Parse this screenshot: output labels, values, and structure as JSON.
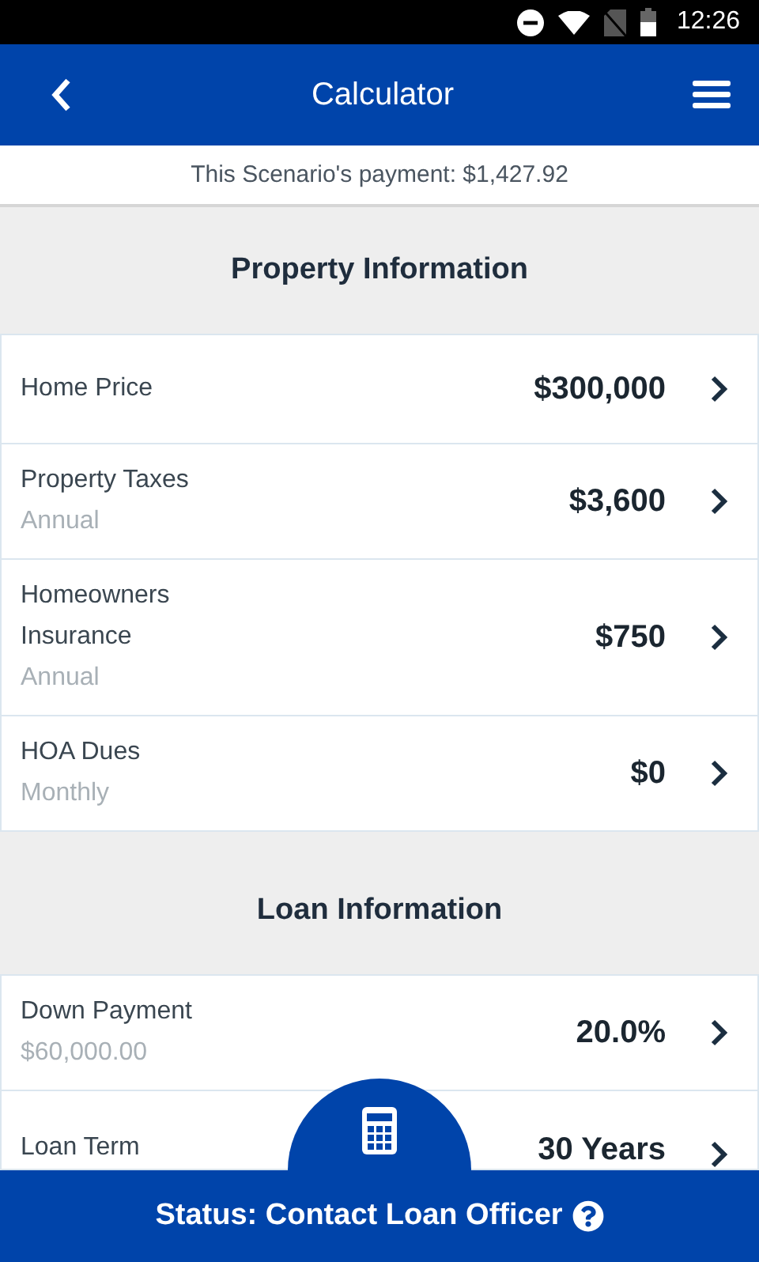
{
  "status_bar": {
    "time": "12:26"
  },
  "header": {
    "title": "Calculator"
  },
  "payment": {
    "text": "This Scenario's payment: $1,427.92"
  },
  "sections": [
    {
      "title": "Property Information",
      "rows": [
        {
          "label": "Home Price",
          "value": "$300,000"
        },
        {
          "label": "Property Taxes",
          "sub": "Annual",
          "value": "$3,600"
        },
        {
          "label": "Homeowners Insurance",
          "sub": "Annual",
          "value": "$750"
        },
        {
          "label": "HOA Dues",
          "sub": "Monthly",
          "value": "$0"
        }
      ]
    },
    {
      "title": "Loan Information",
      "rows": [
        {
          "label": "Down Payment",
          "sub": "$60,000.00",
          "value": "20.0%"
        },
        {
          "label": "Loan Term",
          "value": "30 Years"
        }
      ]
    }
  ],
  "footer": {
    "status": "Status: Contact Loan Officer"
  }
}
